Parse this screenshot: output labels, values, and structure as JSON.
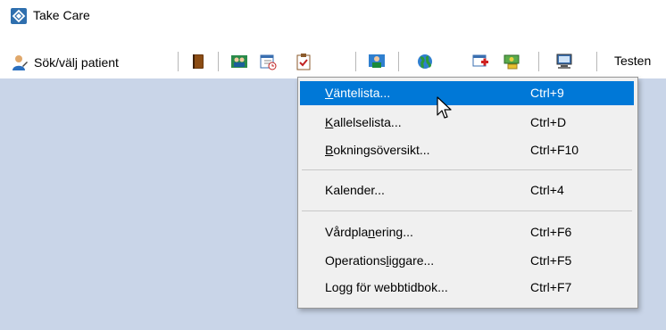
{
  "window": {
    "title": "Take Care"
  },
  "toolbar": {
    "patient_label": "Sök/välj patient",
    "right_label": "Testen",
    "icons": [
      "journal-book-icon",
      "people-icon",
      "calendar-clock-icon",
      "clipboard-check-icon",
      "person-board-icon",
      "globe-icon",
      "medical-cross-icon",
      "money-icon",
      "computer-icon"
    ]
  },
  "menu": {
    "items": [
      {
        "label": "Väntelista...",
        "mnemonic": "V",
        "shortcut": "Ctrl+9",
        "highlighted": true
      },
      {
        "label": "Kallelselista...",
        "mnemonic": "K",
        "shortcut": "Ctrl+D"
      },
      {
        "label": "Bokningsöversikt...",
        "mnemonic": "B",
        "shortcut": "Ctrl+F10"
      },
      {
        "label": "Kalender...",
        "shortcut": "Ctrl+4"
      },
      {
        "label": "Vårdplanering...",
        "mnemonic": "n",
        "shortcut": "Ctrl+F6"
      },
      {
        "label": "Operationsliggare...",
        "mnemonic": "l",
        "shortcut": "Ctrl+F5"
      },
      {
        "label": "Logg för webbtidbok...",
        "shortcut": "Ctrl+F7"
      }
    ]
  },
  "colors": {
    "accent": "#0078d7",
    "workarea": "#c9d5e8",
    "menu_bg": "#f0f0f0"
  }
}
